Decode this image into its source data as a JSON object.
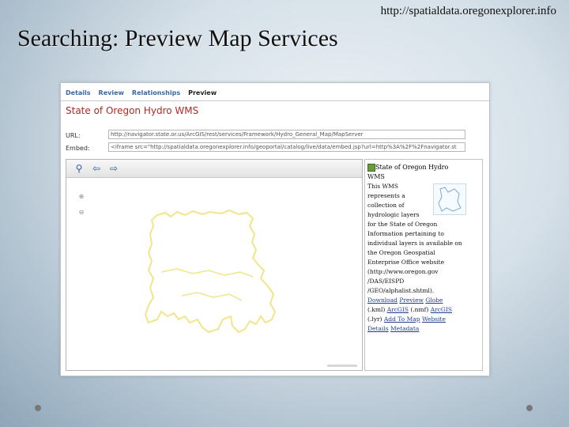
{
  "header": {
    "url": "http://spatialdata.oregonexplorer.info",
    "title": "Searching: Preview Map Services"
  },
  "tabs": [
    {
      "label": "Details"
    },
    {
      "label": "Review"
    },
    {
      "label": "Relationships"
    },
    {
      "label": "Preview"
    }
  ],
  "service": {
    "title": "State of Oregon Hydro WMS",
    "url_label": "URL:",
    "url_value": "http://navigator.state.or.us/ArcGIS/rest/services/Framework/Hydro_General_Map/MapServer",
    "embed_label": "Embed:",
    "embed_value": "<iframe src=\"http://spatialdata.oregonexplorer.info/geoportal/catalog/live/data/embed.jsp?url=http%3A%2F%2Fnavigator.st"
  },
  "map": {
    "toolbar": {
      "info_icon": "map-info-icon",
      "back_icon": "back-arrow-icon",
      "forward_icon": "forward-arrow-icon"
    },
    "outline_color": "#f1e58a"
  },
  "info": {
    "title_line1": "State of Oregon Hydro",
    "title_line2": "WMS",
    "lines": [
      "This WMS",
      "represents a",
      "collection of",
      "hydrologic layers",
      "for the State of Oregon",
      "Information pertaining to",
      "individual layers is available on",
      "the Oregon Geospatial",
      "Enterprise Office website",
      "(http://www.oregon.gov",
      "/DAS/EISPD",
      "/GEO/alphalist.shtml)."
    ],
    "links_line1": {
      "download": "Download",
      "preview": "Preview",
      "globe": "Globe"
    },
    "links_line2": {
      "kml_label": "(.kml)",
      "arcgis1": "ArcGIS",
      "lmf_label": "(.nmf)",
      "arcgis2": "ArcGIS"
    },
    "links_line3": {
      "lyr_label": "(.lyr)",
      "add_to_map": "Add To Map",
      "website": "Website"
    },
    "links_line4": {
      "details": "Details",
      "metadata": "Metadata"
    }
  }
}
